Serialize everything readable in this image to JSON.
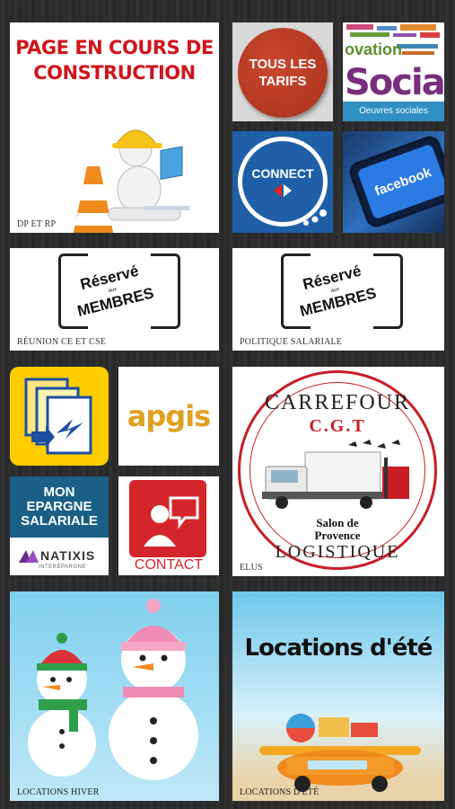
{
  "tiles": {
    "construction": {
      "title": "PAGE EN COURS DE CONSTRUCTION",
      "caption": "DP ET RP"
    },
    "tarifs": {
      "label": "TOUS LES TARIFS"
    },
    "social": {
      "headline": "Social",
      "fragment": "ovation",
      "subtitle": "Oeuvres sociales"
    },
    "connect": {
      "label": "CONNECT"
    },
    "facebook": {
      "label": "facebook"
    },
    "reunion": {
      "stamp_line1": "Réservé",
      "stamp_aux": "aux",
      "stamp_line2": "MEMBRES",
      "caption": "RÉUNION CE ET CSE"
    },
    "politique": {
      "stamp_line1": "Réservé",
      "stamp_aux": "aux",
      "stamp_line2": "MEMBRES",
      "caption": "POLITIQUE SALARIALE"
    },
    "apgis": {
      "label": "apgis"
    },
    "epargne": {
      "line1": "MON",
      "line2": "EPARGNE",
      "line3": "SALARIALE",
      "brand": "NATIXIS",
      "brand_sub": "INTERÉPARGNE"
    },
    "contact": {
      "label": "CONTACT"
    },
    "elus": {
      "top": "CARREFOUR",
      "middle": "C.G.T",
      "place1": "Salon de",
      "place2": "Provence",
      "bottom": "LOGISTIQUE",
      "caption": "ELUS"
    },
    "hiver": {
      "caption": "LOCATIONS HIVER"
    },
    "ete": {
      "title": "Locations d'été",
      "caption": "LOCATIONS D'ÉTÉ"
    }
  },
  "colors": {
    "accent_red": "#d0141c",
    "facebook_blue": "#2c7be5",
    "carrefour_blue": "#1f5fa8",
    "poste_yellow": "#ffcc00",
    "natixis_blue": "#1a5f86"
  }
}
